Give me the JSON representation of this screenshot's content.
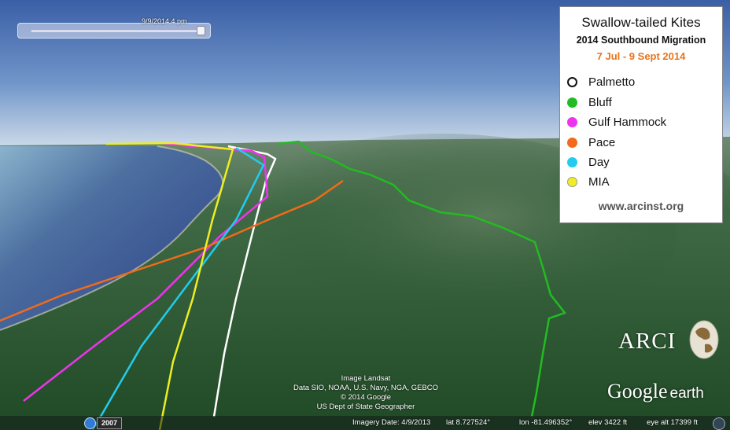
{
  "time_slider": {
    "label": "9/9/2014   4 pm",
    "position": 0.97
  },
  "legend": {
    "title": "Swallow-tailed Kites",
    "subtitle": "2014 Southbound Migration",
    "date_range": "7 Jul - 9 Sept 2014",
    "items": [
      {
        "label": "Palmetto",
        "color": "#ffffff"
      },
      {
        "label": "Bluff",
        "color": "#22bb22"
      },
      {
        "label": "Gulf Hammock",
        "color": "#ee33ee"
      },
      {
        "label": "Pace",
        "color": "#f26a1a"
      },
      {
        "label": "Day",
        "color": "#22ccee"
      },
      {
        "label": "MIA",
        "color": "#eeee22"
      }
    ],
    "url": "www.arcinst.org"
  },
  "logo": {
    "arci": "ARCI"
  },
  "brand": {
    "google": "Google",
    "earth": "earth"
  },
  "credits": {
    "line1": "Image Landsat",
    "line2": "Data SIO, NOAA, U.S. Navy, NGA, GEBCO",
    "line3": "© 2014 Google",
    "line4": "US Dept of State Geographer"
  },
  "status": {
    "historical_year": "2007",
    "imagery_date": "Imagery Date: 4/9/2013",
    "lat": "lat    8.727524°",
    "lon": "lon  -81.496352°",
    "elev": "elev  3422 ft",
    "eye_alt": "eye alt  17399 ft"
  }
}
